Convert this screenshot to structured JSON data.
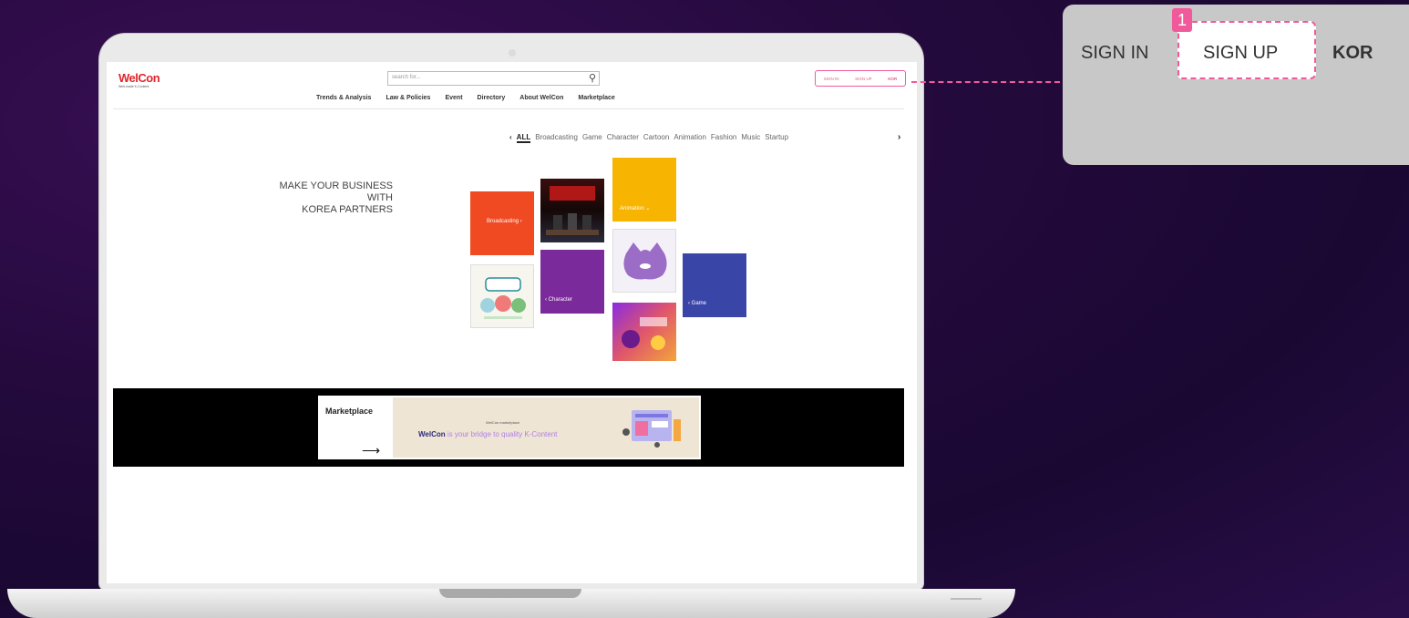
{
  "site": {
    "logo": "WelCon",
    "logo_sub": "Well-made K-Content",
    "search_placeholder": "search for...",
    "nav": [
      "Trends & Analysis",
      "Law & Policies",
      "Event",
      "Directory",
      "About WelCon",
      "Marketplace"
    ],
    "auth": {
      "signin": "SIGN IN",
      "signup": "SIGN UP",
      "lang": "KOR"
    },
    "categories": [
      "ALL",
      "Broadcasting",
      "Game",
      "Character",
      "Cartoon",
      "Animation",
      "Fashion",
      "Music",
      "Startup"
    ],
    "hero": [
      "MAKE YOUR BUSINESS",
      "WITH",
      "KOREA PARTNERS"
    ],
    "tiles": {
      "broadcasting": "Broadcasting ›",
      "animation": "Animation ⌄",
      "character": "‹ Character",
      "game": "‹ Game"
    },
    "banner": {
      "title": "Marketplace",
      "ad_small": "WelCon marketplace",
      "ad_brand": "WelCon",
      "ad_tagline": "is your bridge to quality K-Content"
    }
  },
  "callout": {
    "badge": "1",
    "signin": "SIGN IN",
    "signup": "SIGN UP",
    "lang": "KOR"
  }
}
